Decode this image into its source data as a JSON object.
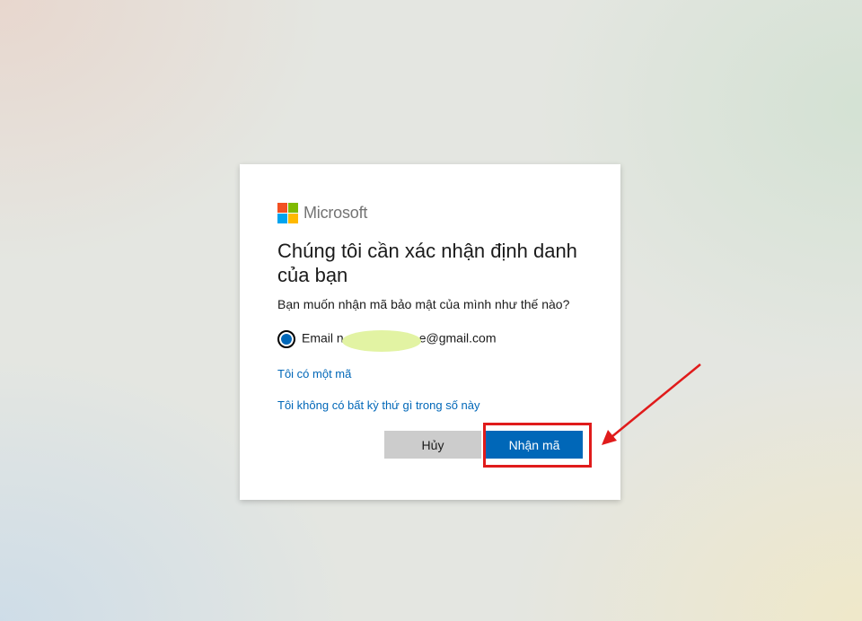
{
  "brand": {
    "name": "Microsoft",
    "colors": [
      "#f25022",
      "#7fba00",
      "#00a4ef",
      "#ffb900"
    ]
  },
  "dialog": {
    "title": "Chúng tôi cần xác nhận định danh của bạn",
    "subtitle": "Bạn muốn nhận mã bảo mật của mình như thế nào?",
    "option": {
      "prefix": "Email",
      "lead_char": "n",
      "tail_char": "e",
      "suffix": "@gmail.com",
      "selected": true
    },
    "links": {
      "have_code": "Tôi có một mã",
      "none": "Tôi không có bất kỳ thứ gì trong số này"
    },
    "buttons": {
      "cancel": "Hủy",
      "primary": "Nhận mã"
    }
  },
  "annotation": {
    "color": "#e01b1b",
    "target": "primary-button"
  }
}
